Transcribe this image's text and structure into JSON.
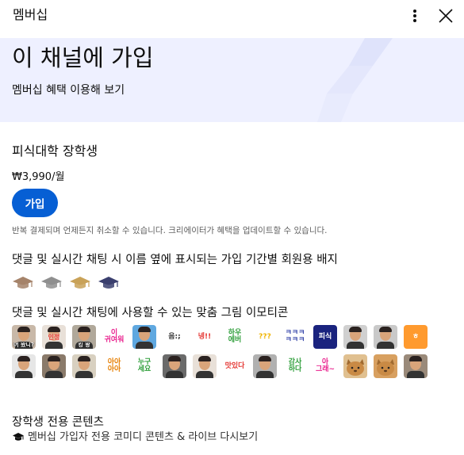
{
  "header": {
    "title": "멤버십",
    "more_icon": "more-vert-icon",
    "close_icon": "close-icon"
  },
  "hero": {
    "heading": "이 채널에 가입",
    "subtitle": "멤버십 혜택 이용해 보기",
    "background": "#eef0ff"
  },
  "tier": {
    "name": "피식대학 장학생",
    "price": "₩3,990/월",
    "join_label": "가입",
    "notice": "반복 결제되며 언제든지 취소할 수 있습니다. 크리에이터가 혜택을 업데이트할 수 있습니다."
  },
  "badges": {
    "title": "댓글 및 실시간 채팅 시 이름 옆에 표시되는 가입 기간별 회원용 배지",
    "items": [
      {
        "name": "graduation-cap-bronze",
        "color": "#a5836a"
      },
      {
        "name": "graduation-cap-silver",
        "color": "#8f8f8f"
      },
      {
        "name": "graduation-cap-gold",
        "color": "#c9a258"
      },
      {
        "name": "graduation-cap-navy",
        "color": "#3a3f6e"
      }
    ]
  },
  "emojis": {
    "title": "댓글 및 실시간 채팅에 사용할 수 있는 맞춤 그림 이모티콘",
    "items": [
      {
        "kind": "face",
        "caption": "어 왔니?",
        "bg": "#c8b8a8"
      },
      {
        "kind": "face",
        "caption": "",
        "bg": "#e8e0d8",
        "text": "인정",
        "textColor": "#e53935"
      },
      {
        "kind": "face",
        "caption": "킹 왕",
        "bg": "#b0a89a"
      },
      {
        "kind": "text",
        "text": "이\n귀여워",
        "bg": "#ffffff",
        "textColor": "#e91e8c"
      },
      {
        "kind": "face",
        "caption": "",
        "bg": "#5fa8e0"
      },
      {
        "kind": "text",
        "text": "음:;",
        "bg": "#ffffff",
        "textColor": "#333333"
      },
      {
        "kind": "text",
        "text": "넹!!",
        "bg": "#ffffff",
        "textColor": "#e53935"
      },
      {
        "kind": "text",
        "text": "하우\n에버",
        "bg": "#ffffff",
        "textColor": "#2e9e3a"
      },
      {
        "kind": "text",
        "text": "???",
        "bg": "#ffffff",
        "textColor": "#f0b400"
      },
      {
        "kind": "text",
        "text": "ㅋㅋㅋ\nㅋㅋㅋ",
        "bg": "#ffffff",
        "textColor": "#3949ab"
      },
      {
        "kind": "text",
        "text": "피식",
        "bg": "#1a237e",
        "textColor": "#ffffff"
      },
      {
        "kind": "face",
        "caption": "",
        "bg": "#d0d0d0"
      },
      {
        "kind": "face",
        "caption": "",
        "bg": "#c9c9c9"
      },
      {
        "kind": "text",
        "text": "ㅎ",
        "bg": "#ff9a2e",
        "textColor": "#ffffff"
      },
      {
        "kind": "face",
        "caption": "",
        "bg": "#e6e6e6"
      },
      {
        "kind": "face",
        "caption": "",
        "bg": "#8a7a6a"
      },
      {
        "kind": "face",
        "caption": "",
        "bg": "#d8d0c0"
      },
      {
        "kind": "text",
        "text": "아아\n아아",
        "bg": "#ffffff",
        "textColor": "#e67e00"
      },
      {
        "kind": "text",
        "text": "누구\n세요",
        "bg": "#ffffff",
        "textColor": "#2e9e3a"
      },
      {
        "kind": "face",
        "caption": "",
        "bg": "#6a6a6a"
      },
      {
        "kind": "face",
        "caption": "",
        "bg": "#e8e0d8"
      },
      {
        "kind": "text",
        "text": "맛있다",
        "bg": "#ffffff",
        "textColor": "#e53935"
      },
      {
        "kind": "face",
        "caption": "",
        "bg": "#b0b0b0"
      },
      {
        "kind": "text",
        "text": "감사\n하다",
        "bg": "#ffffff",
        "textColor": "#2e9e3a"
      },
      {
        "kind": "text",
        "text": "아\n그래~",
        "bg": "#ffffff",
        "textColor": "#e91e8c"
      },
      {
        "kind": "animal",
        "bg": "#e0c090"
      },
      {
        "kind": "animal",
        "bg": "#d8a060"
      },
      {
        "kind": "face",
        "caption": "",
        "bg": "#9a8a7a"
      }
    ]
  },
  "exclusive": {
    "title": "장학생 전용 콘텐츠",
    "item": "멤버십 가입자 전용 코미디 콘텐츠 & 라이브 다시보기",
    "item_icon": "graduation-cap-icon"
  },
  "colors": {
    "accent": "#065fd4",
    "hero": "#eef0ff"
  }
}
